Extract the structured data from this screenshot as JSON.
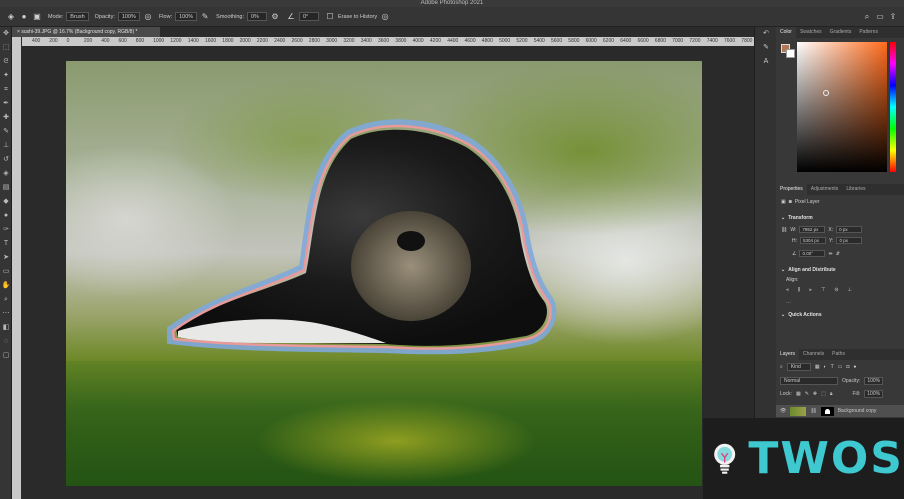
{
  "window": {
    "title": "Adobe Photoshop 2021"
  },
  "options_bar": {
    "mode_label": "Mode:",
    "mode_value": "Brush",
    "opacity_label": "Opacity:",
    "opacity_value": "100%",
    "flow_label": "Flow:",
    "flow_value": "100%",
    "smoothing_label": "Smoothing:",
    "smoothing_value": "0%",
    "angle_value": "0°",
    "erase_history_label": "Erase to History"
  },
  "document": {
    "tab_label": "sushi-39.JPG @ 16.7% (Background copy, RGB/8) *",
    "ruler_ticks": [
      "400",
      "200",
      "0",
      "200",
      "400",
      "600",
      "800",
      "1000",
      "1200",
      "1400",
      "1600",
      "1800",
      "2000",
      "2200",
      "2400",
      "2600",
      "2800",
      "3000",
      "3200",
      "3400",
      "3600",
      "3800",
      "4000",
      "4200",
      "4400",
      "4600",
      "4800",
      "5000",
      "5200",
      "5400",
      "5600",
      "5800",
      "6000",
      "6200",
      "6400",
      "6600",
      "6800",
      "7000",
      "7200",
      "7400",
      "7600",
      "7800"
    ]
  },
  "color_panel": {
    "tabs": [
      "Color",
      "Swatches",
      "Gradients",
      "Patterns"
    ],
    "active_tab": "Color"
  },
  "properties_panel": {
    "tabs": [
      "Properties",
      "Adjustments",
      "Libraries"
    ],
    "layer_type": "Pixel Layer",
    "transform_label": "Transform",
    "w_label": "W:",
    "w_value": "7952 px",
    "h_label": "H:",
    "h_value": "5304 px",
    "x_label": "X:",
    "x_value": "0 px",
    "y_label": "Y:",
    "y_value": "0 px",
    "angle_value": "0.00°",
    "align_label": "Align and Distribute",
    "align_sub": "Align:",
    "quick_actions": "Quick Actions"
  },
  "layers_panel": {
    "tabs": [
      "Layers",
      "Channels",
      "Paths"
    ],
    "filter_kind": "Kind",
    "blend_mode": "Normal",
    "opacity_label": "Opacity:",
    "opacity_value": "100%",
    "lock_label": "Lock:",
    "fill_label": "Fill:",
    "fill_value": "100%",
    "layer_name": "Background copy"
  },
  "watermark": {
    "text": "TWOS"
  }
}
